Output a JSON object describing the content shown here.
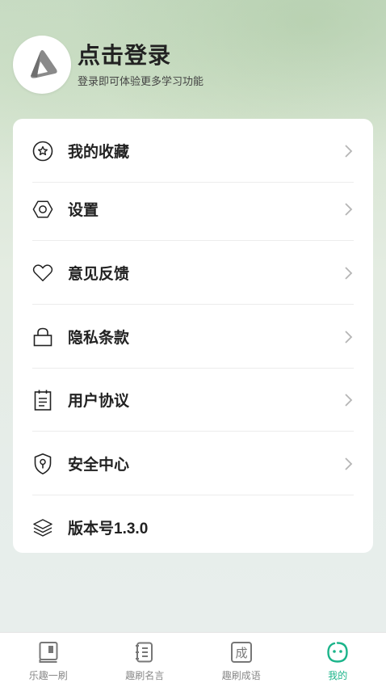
{
  "profile": {
    "title": "点击登录",
    "subtitle": "登录即可体验更多学习功能"
  },
  "menu": {
    "items": [
      {
        "label": "我的收藏",
        "icon": "star-circle-icon"
      },
      {
        "label": "设置",
        "icon": "hexagon-nut-icon"
      },
      {
        "label": "意见反馈",
        "icon": "heart-icon"
      },
      {
        "label": "隐私条款",
        "icon": "lock-icon"
      },
      {
        "label": "用户协议",
        "icon": "clipboard-icon"
      },
      {
        "label": "安全中心",
        "icon": "shield-keyhole-icon"
      },
      {
        "label": "版本号1.3.0",
        "icon": "layers-icon"
      }
    ]
  },
  "tabbar": {
    "tabs": [
      {
        "label": "乐趣一刷",
        "icon": "book-icon",
        "active": false
      },
      {
        "label": "趣刷名言",
        "icon": "scroll-icon",
        "active": false
      },
      {
        "label": "趣刷成语",
        "icon": "idiom-cheng-icon",
        "active": false,
        "glyph": "成"
      },
      {
        "label": "我的",
        "icon": "smiley-face-icon",
        "active": true
      }
    ]
  },
  "colors": {
    "accent": "#1bb48a",
    "text": "#222222",
    "inactive": "#888888"
  }
}
